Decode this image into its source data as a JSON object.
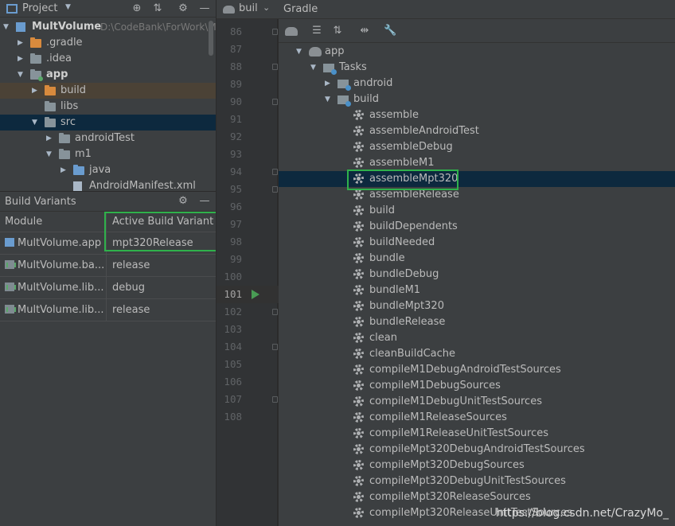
{
  "project_panel": {
    "title": "Project",
    "tree": [
      {
        "label": "MultVolume",
        "path": "D:\\CodeBank\\ForWork\\M",
        "depth": 0,
        "expanded": true,
        "bold": true,
        "icon": "module"
      },
      {
        "label": ".gradle",
        "depth": 1,
        "expanded": false,
        "icon": "folder-orange"
      },
      {
        "label": ".idea",
        "depth": 1,
        "expanded": false,
        "icon": "folder"
      },
      {
        "label": "app",
        "depth": 1,
        "expanded": true,
        "bold": true,
        "icon": "module-folder"
      },
      {
        "label": "build",
        "depth": 2,
        "expanded": false,
        "icon": "folder-orange"
      },
      {
        "label": "libs",
        "depth": 2,
        "expanded": null,
        "icon": "folder"
      },
      {
        "label": "src",
        "depth": 2,
        "expanded": true,
        "icon": "folder"
      },
      {
        "label": "androidTest",
        "depth": 3,
        "expanded": false,
        "icon": "folder"
      },
      {
        "label": "m1",
        "depth": 3,
        "expanded": true,
        "icon": "folder"
      },
      {
        "label": "java",
        "depth": 4,
        "expanded": false,
        "icon": "folder-blue"
      },
      {
        "label": "AndroidManifest.xml",
        "depth": 4,
        "expanded": null,
        "icon": "xml-file"
      }
    ]
  },
  "build_variants": {
    "title": "Build Variants",
    "columns": [
      "Module",
      "Active Build Variant"
    ],
    "rows": [
      {
        "module": "MultVolume.app",
        "variant": "mpt320Release",
        "type": "app"
      },
      {
        "module": "MultVolume.ba...",
        "variant": "release",
        "type": "lib"
      },
      {
        "module": "MultVolume.lib...",
        "variant": "debug",
        "type": "lib"
      },
      {
        "module": "MultVolume.lib...",
        "variant": "release",
        "type": "lib"
      }
    ]
  },
  "editor": {
    "tab_label": "buil",
    "line_numbers": [
      "86",
      "87",
      "88",
      "89",
      "90",
      "91",
      "92",
      "93",
      "94",
      "95",
      "96",
      "97",
      "98",
      "99",
      "100",
      "101",
      "102",
      "103",
      "104",
      "105",
      "106",
      "107",
      "108"
    ],
    "current_line": "101"
  },
  "gradle_panel": {
    "title": "Gradle",
    "root": "app",
    "tasks_label": "Tasks",
    "groups": [
      "android",
      "build"
    ],
    "build_tasks": [
      "assemble",
      "assembleAndroidTest",
      "assembleDebug",
      "assembleM1",
      "assembleMpt320",
      "assembleRelease",
      "build",
      "buildDependents",
      "buildNeeded",
      "bundle",
      "bundleDebug",
      "bundleM1",
      "bundleMpt320",
      "bundleRelease",
      "clean",
      "cleanBuildCache",
      "compileM1DebugAndroidTestSources",
      "compileM1DebugSources",
      "compileM1DebugUnitTestSources",
      "compileM1ReleaseSources",
      "compileM1ReleaseUnitTestSources",
      "compileMpt320DebugAndroidTestSources",
      "compileMpt320DebugSources",
      "compileMpt320DebugUnitTestSources",
      "compileMpt320ReleaseSources",
      "compileMpt320ReleaseUnitTestSources"
    ],
    "selected_task": "assembleMpt320"
  },
  "footer_url": "https://blog.csdn.net/CrazyMo_",
  "colors": {
    "highlight_box": "#2fb14b",
    "selection": "#0d293e",
    "accent_run": "#499c54"
  }
}
